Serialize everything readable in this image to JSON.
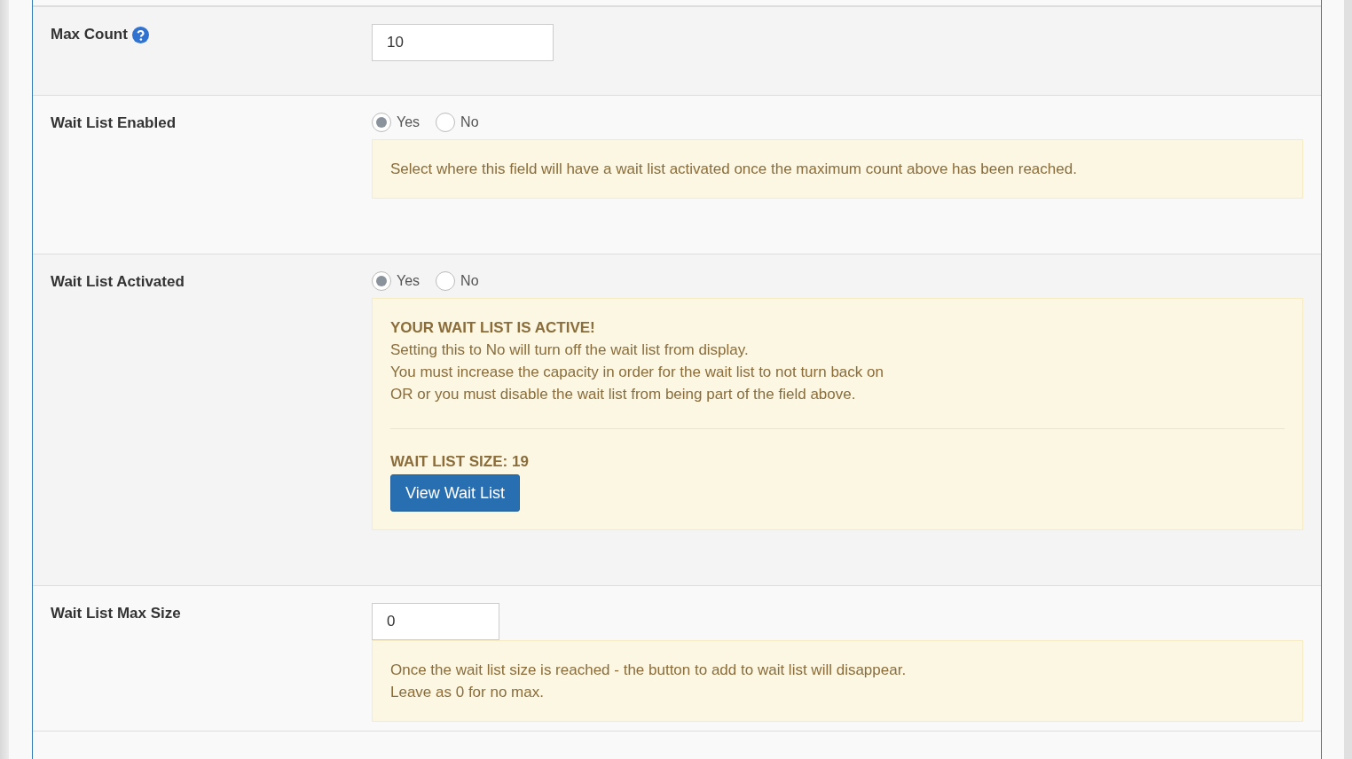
{
  "rows": [
    {
      "label": "Max Count",
      "help": true,
      "kind": "input",
      "value": "10"
    },
    {
      "label": "Wait List Enabled",
      "help": false,
      "kind": "radio",
      "options": [
        {
          "label": "Yes",
          "selected": true
        },
        {
          "label": "No",
          "selected": false
        }
      ],
      "note": [
        {
          "kind": "text",
          "text": "Select where this field will have a wait list activated once the maximum count above has been reached."
        }
      ]
    },
    {
      "label": "Wait List Activated",
      "help": false,
      "kind": "radio",
      "options": [
        {
          "label": "Yes",
          "selected": true
        },
        {
          "label": "No",
          "selected": false
        }
      ],
      "note": [
        {
          "kind": "heading",
          "text": "YOUR WAIT LIST IS ACTIVE!"
        },
        {
          "kind": "text",
          "text": "Setting this to No will turn off the wait list from display."
        },
        {
          "kind": "text",
          "text": "You must increase the capacity in order for the wait list to not turn back on"
        },
        {
          "kind": "text",
          "text": "OR or you must disable the wait list from being part of the field above."
        },
        {
          "kind": "rule"
        },
        {
          "kind": "heading",
          "text": "WAIT LIST SIZE: 19"
        },
        {
          "kind": "button",
          "text": "View Wait List"
        }
      ]
    },
    {
      "label": "Wait List Max Size",
      "help": false,
      "kind": "input",
      "value": "0",
      "note": [
        {
          "kind": "text",
          "text": "Once the wait list size is reached - the button to add to wait list will disappear."
        },
        {
          "kind": "text",
          "text": "Leave as 0 for no max."
        }
      ]
    }
  ]
}
